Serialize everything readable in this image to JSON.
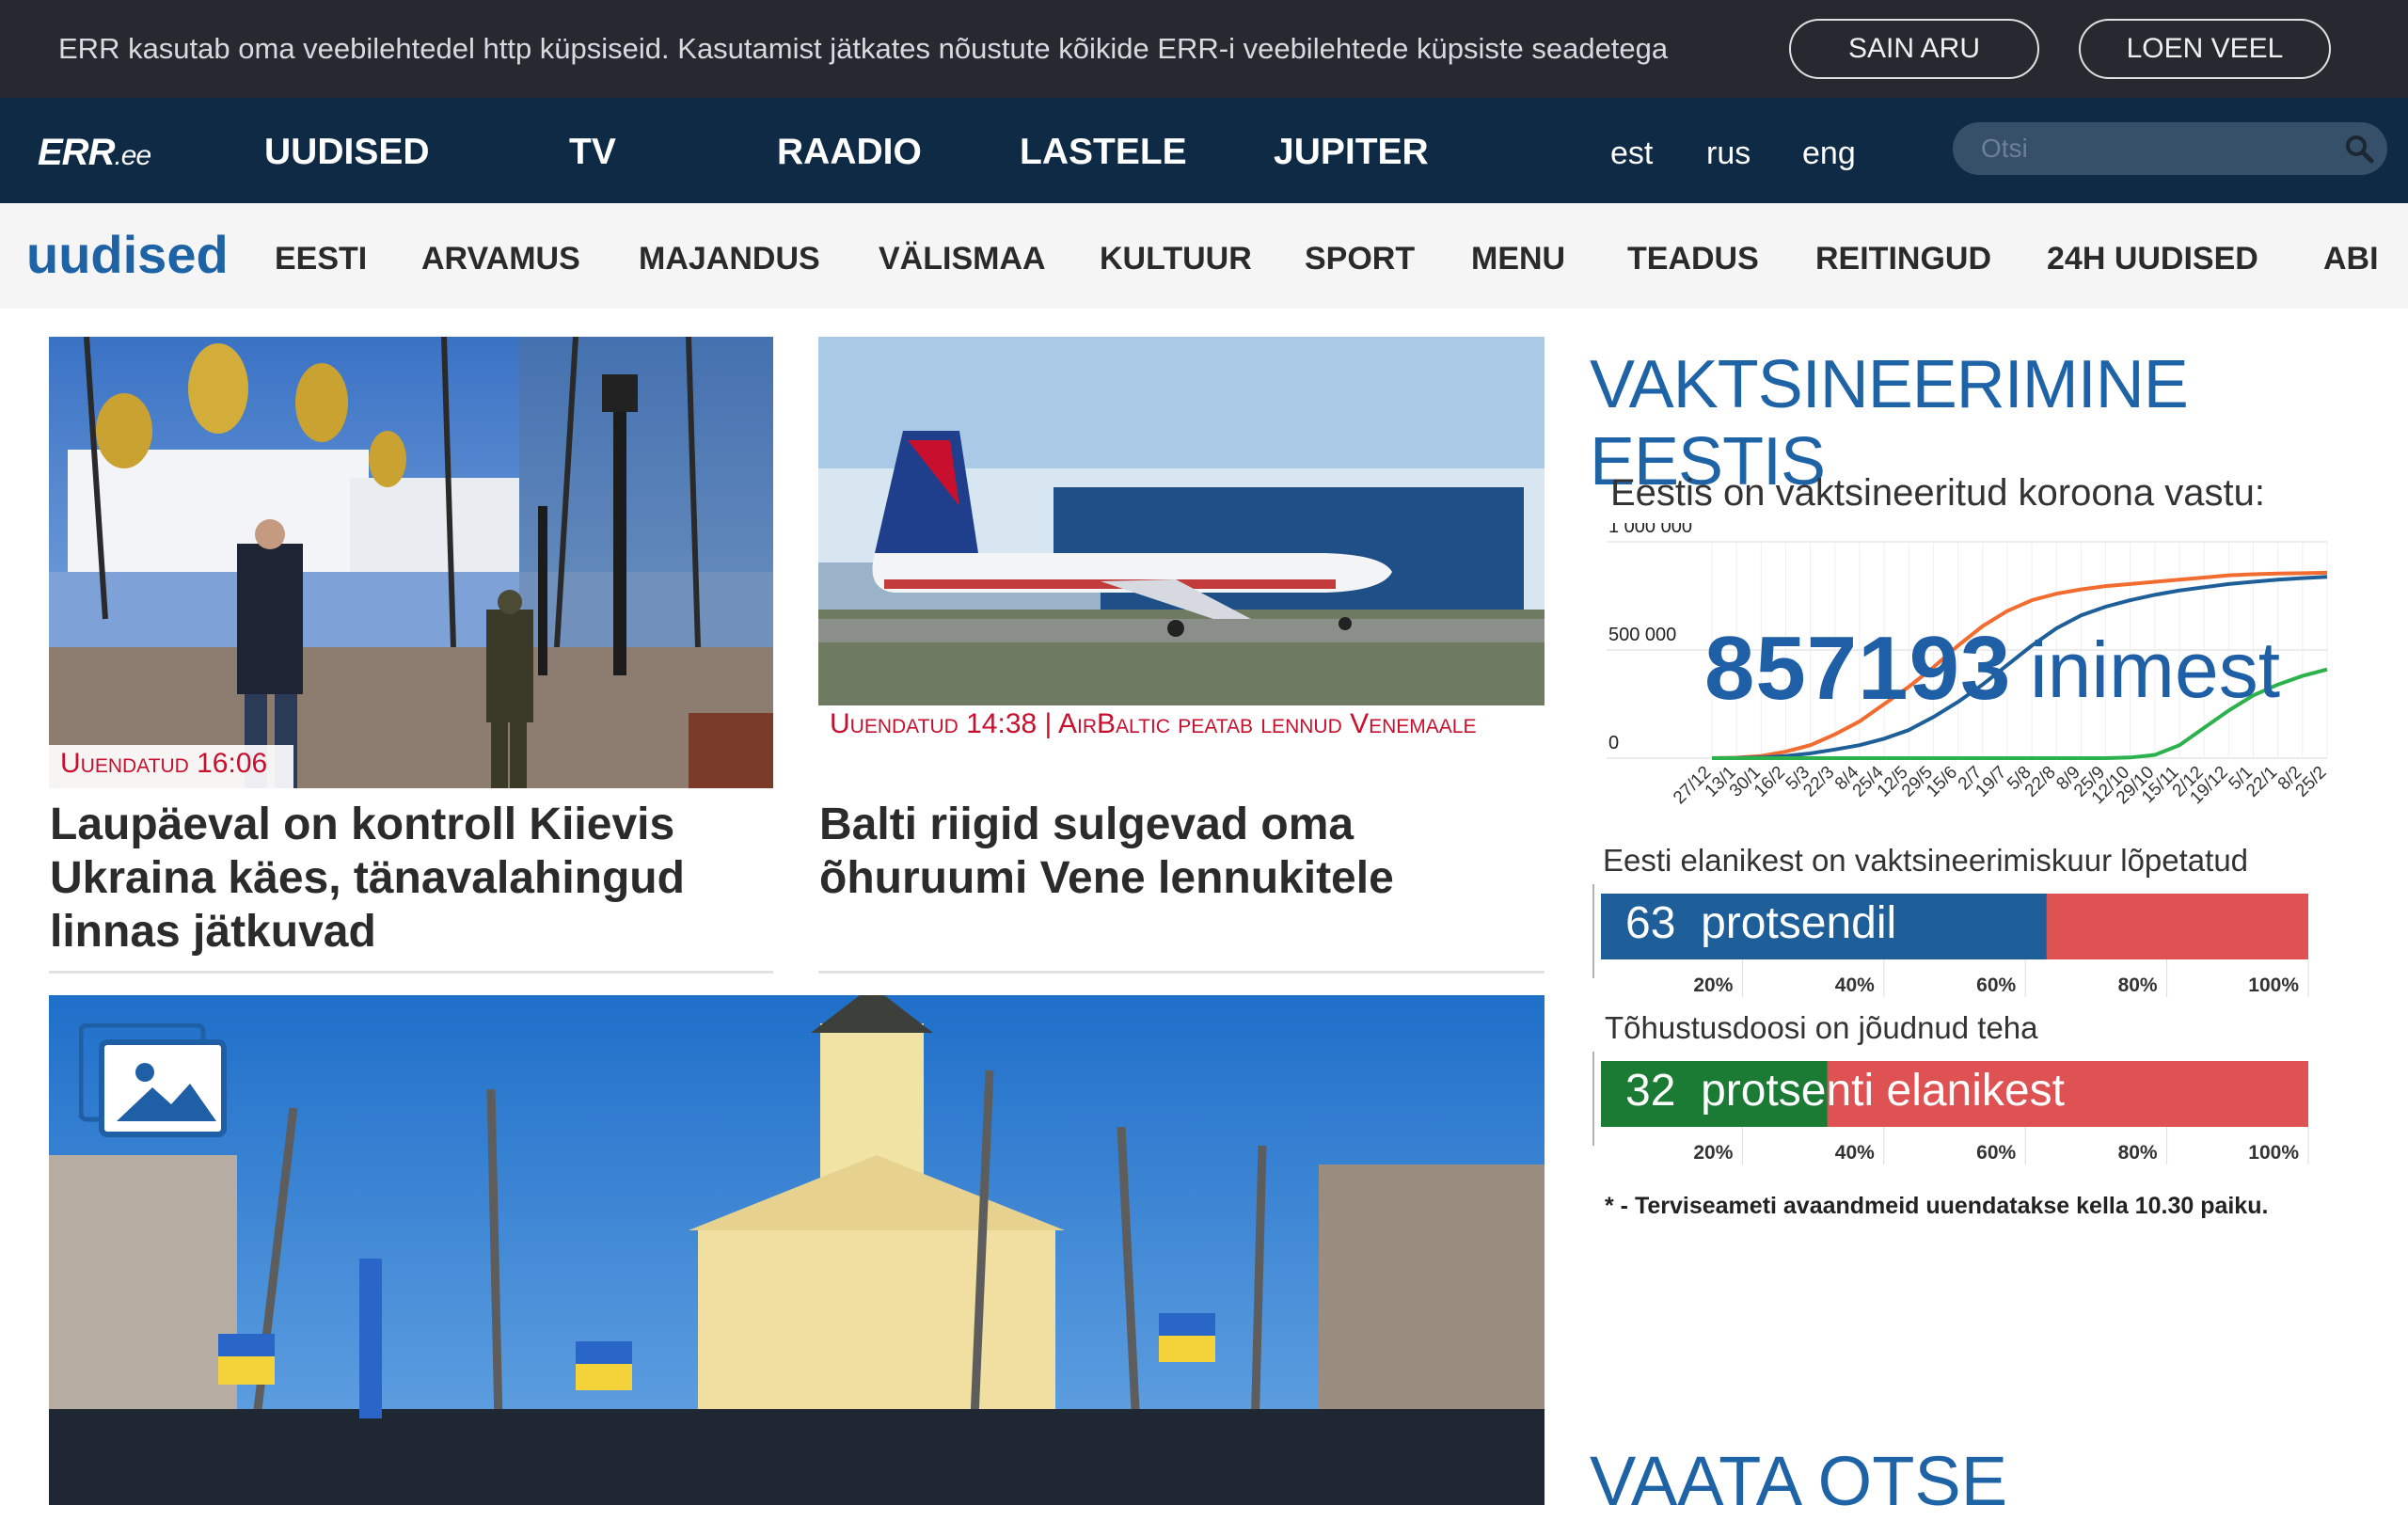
{
  "cookie": {
    "text": "ERR kasutab oma veebilehtedel http küpsiseid. Kasutamist jätkates nõustute kõikide ERR-i veebilehtede küpsiste seadetega",
    "accept_label": "SAIN ARU",
    "more_label": "LOEN VEEL"
  },
  "header": {
    "logo": "ERR",
    "logo_suffix": ".ee",
    "nav": [
      "UUDISED",
      "TV",
      "RAADIO",
      "LASTELE",
      "JUPITER"
    ],
    "languages": [
      "est",
      "rus",
      "eng"
    ],
    "search_placeholder": "Otsi"
  },
  "subnav": {
    "brand": "uudised",
    "items": [
      "EESTI",
      "ARVAMUS",
      "MAJANDUS",
      "VÄLISMAA",
      "KULTUUR",
      "SPORT",
      "MENU",
      "TEADUS",
      "REITINGUD",
      "24H UUDISED",
      "ABI"
    ]
  },
  "articles": [
    {
      "kicker": "Uuendatud 16:06",
      "headline": "Laupäeval on kontroll Kiievis Ukraina käes, tänavalahingud linnas jätkuvad"
    },
    {
      "kicker": "Uuendatud 14:38 | AirBaltic peatab lennud Venemaale",
      "headline": "Balti riigid sulgevad oma õhuruumi Vene lennukitele"
    }
  ],
  "gallery_icon": "image-gallery-icon",
  "vaccination": {
    "title": "VAKTSINEERIMINE EESTIS",
    "subtitle": "Eestis on vaktsineeritud koroona vastu:",
    "count": "857193",
    "count_unit": "inimest",
    "completed_label": "Eesti elanikest on vaktsineerimiskuur lõpetatud",
    "completed_value_text": "63",
    "completed_unit": "protsendil",
    "booster_label": "Tõhustusdoosi on jõudnud teha",
    "booster_value_text": "32",
    "booster_unit": "protsenti elanikest",
    "note": "* - Terviseameti avaandmeid uuendatakse kella 10.30 paiku.",
    "colors": {
      "orange": "#f26b2f",
      "blue": "#1f5f99",
      "green": "#2bb24c",
      "red": "#de5254",
      "darkgreen": "#1b7a33"
    }
  },
  "chart_data": [
    {
      "type": "line",
      "title": "",
      "x": [
        "27/12",
        "13/1",
        "30/1",
        "16/2",
        "5/3",
        "22/3",
        "8/4",
        "25/4",
        "12/5",
        "29/5",
        "15/6",
        "2/7",
        "19/7",
        "5/8",
        "22/8",
        "8/9",
        "25/9",
        "12/10",
        "29/10",
        "15/11",
        "2/12",
        "19/12",
        "5/1",
        "22/1",
        "8/2",
        "25/2"
      ],
      "yticks": [
        "0",
        "500 000",
        "1 000 000"
      ],
      "ylim": [
        0,
        1000000
      ],
      "series": [
        {
          "color": "#f26b2f",
          "values": [
            0,
            2000,
            10000,
            30000,
            60000,
            110000,
            170000,
            250000,
            330000,
            420000,
            520000,
            610000,
            680000,
            730000,
            760000,
            780000,
            795000,
            805000,
            815000,
            825000,
            835000,
            845000,
            850000,
            853000,
            855000,
            857193
          ]
        },
        {
          "color": "#1f5f99",
          "values": [
            0,
            500,
            3000,
            10000,
            22000,
            40000,
            60000,
            90000,
            130000,
            190000,
            260000,
            340000,
            430000,
            520000,
            600000,
            660000,
            700000,
            730000,
            755000,
            775000,
            790000,
            805000,
            815000,
            825000,
            832000,
            838000
          ]
        },
        {
          "color": "#2bb24c",
          "values": [
            0,
            0,
            0,
            0,
            0,
            0,
            0,
            0,
            0,
            0,
            0,
            0,
            0,
            0,
            0,
            0,
            0,
            3000,
            15000,
            60000,
            140000,
            220000,
            290000,
            340000,
            380000,
            410000
          ]
        }
      ],
      "grid": true
    },
    {
      "type": "bar",
      "categories": [
        "completed"
      ],
      "values": [
        63
      ],
      "xticks": [
        "20%",
        "40%",
        "60%",
        "80%",
        "100%"
      ],
      "xlim": [
        0,
        100
      ]
    },
    {
      "type": "bar",
      "categories": [
        "booster"
      ],
      "values": [
        32
      ],
      "xticks": [
        "20%",
        "40%",
        "60%",
        "80%",
        "100%"
      ],
      "xlim": [
        0,
        100
      ]
    }
  ],
  "live": {
    "title": "VAATA OTSE"
  }
}
